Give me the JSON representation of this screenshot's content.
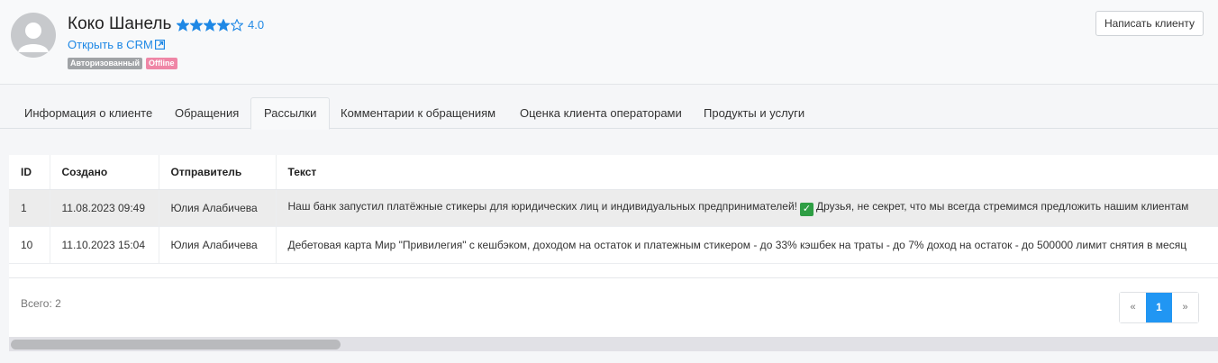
{
  "client": {
    "name": "Коко Шанель",
    "rating_value": "4.0",
    "rating_stars": 4,
    "crm_link": "Открыть в CRM",
    "badges": [
      "Авторизованный",
      "Offline"
    ],
    "write_button": "Написать клиенту"
  },
  "tabs": [
    {
      "label": "Информация о клиенте",
      "active": false
    },
    {
      "label": "Обращения",
      "active": false
    },
    {
      "label": "Рассылки",
      "active": true
    },
    {
      "label": "Комментарии к обращениям",
      "active": false
    },
    {
      "label": "Оценка клиента операторами",
      "active": false
    },
    {
      "label": "Продукты и услуги",
      "active": false
    }
  ],
  "table": {
    "headers": [
      "ID",
      "Создано",
      "Отправитель",
      "Текст"
    ],
    "rows": [
      {
        "id": "1",
        "created": "11.08.2023 09:49",
        "sender": "Юлия Алабичева",
        "text_before": "Наш банк запустил платёжные стикеры для юридических лиц и индивидуальных предпринимателей!",
        "text_after": "Друзья, не секрет, что мы всегда стремимся предложить нашим клиентам",
        "selected": true
      },
      {
        "id": "10",
        "created": "11.10.2023 15:04",
        "sender": "Юлия Алабичева",
        "text_before": "Дебетовая карта Мир \"Привилегия\" с кешбэком, доходом на остаток и платежным стикером - до 33% кэшбек на траты - до 7% доход на остаток - до 500000 лимит снятия в месяц",
        "text_after": "",
        "selected": false
      }
    ]
  },
  "footer": {
    "total": "Всего: 2",
    "pager": {
      "prev": "«",
      "current": "1",
      "next": "»"
    }
  },
  "colors": {
    "accent": "#1e88e5",
    "star": "#1e88e5",
    "page_active": "#2196f3",
    "badge_authorized": "#a0a3a6",
    "badge_offline": "#ef86a6"
  }
}
